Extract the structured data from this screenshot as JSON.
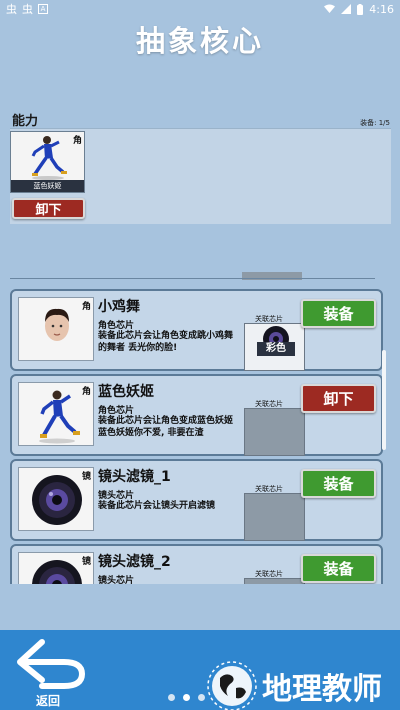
{
  "status_bar": {
    "left_icons": [
      "虫",
      "虫"
    ],
    "badge": "A",
    "time": "4:16"
  },
  "page": {
    "title": "抽象核心"
  },
  "ability": {
    "label": "能力",
    "equip_count": "装备: 1/5",
    "equipped": [
      {
        "name": "蓝色妖姬",
        "tag": "角"
      }
    ],
    "unequip_label": "卸下"
  },
  "chips": [
    {
      "name": "小鸡舞",
      "tag": "角",
      "type": "角色芯片",
      "desc": "装备此芯片会让角色变成跳小鸡舞的舞者 丢光你的脸!",
      "linked_label": "关联芯片",
      "linked_chip": "彩色",
      "action": "装备",
      "action_state": "equip"
    },
    {
      "name": "蓝色妖姬",
      "tag": "角",
      "type": "角色芯片",
      "desc": "装备此芯片会让角色变成蓝色妖姬 蓝色妖姬你不爱, 非要在渣",
      "linked_label": "关联芯片",
      "linked_chip": "",
      "action": "卸下",
      "action_state": "unequip"
    },
    {
      "name": "镜头滤镜_1",
      "tag": "镜",
      "type": "镜头芯片",
      "desc": "装备此芯片会让镜头开启滤镜",
      "linked_label": "关联芯片",
      "linked_chip": "",
      "action": "装备",
      "action_state": "equip"
    },
    {
      "name": "镜头滤镜_2",
      "tag": "镜",
      "type": "镜头芯片",
      "desc": "",
      "linked_label": "关联芯片",
      "linked_chip": "",
      "action": "装备",
      "action_state": "equip"
    }
  ],
  "footer": {
    "back_label": "返回",
    "page_dots": 3,
    "active_dot": 1
  },
  "watermark": {
    "text": "地理教师"
  },
  "colors": {
    "background": "#a7c3de",
    "footer": "#2f86cf",
    "equip_button": "#3f9a30",
    "unequip_button": "#9d2a22",
    "card_bg": "#c4d6e8",
    "card_border": "#5b7a97"
  }
}
